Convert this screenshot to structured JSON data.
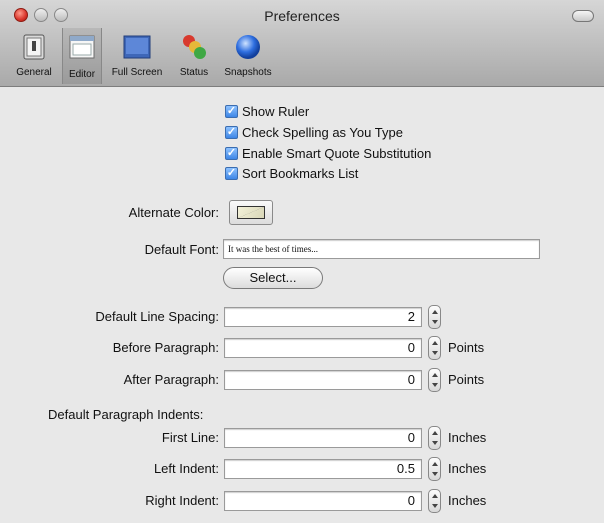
{
  "window": {
    "title": "Preferences"
  },
  "toolbar": {
    "items": [
      {
        "label": "General",
        "icon": "switch-icon"
      },
      {
        "label": "Editor",
        "icon": "editor-window-icon",
        "selected": true
      },
      {
        "label": "Full Screen",
        "icon": "full-screen-icon"
      },
      {
        "label": "Status",
        "icon": "status-lights-icon"
      },
      {
        "label": "Snapshots",
        "icon": "snapshot-orb-icon"
      }
    ]
  },
  "checkboxes": [
    {
      "label": "Show Ruler",
      "checked": true
    },
    {
      "label": "Check Spelling as You Type",
      "checked": true
    },
    {
      "label": "Enable Smart Quote Substitution",
      "checked": true
    },
    {
      "label": "Sort Bookmarks List",
      "checked": true
    }
  ],
  "alternate_color": {
    "label": "Alternate Color:",
    "color": "#ecead0"
  },
  "default_font": {
    "label": "Default Font:",
    "value": "It was the best of times...",
    "select_label": "Select..."
  },
  "spacing": {
    "line_spacing": {
      "label": "Default Line Spacing:",
      "value": "2"
    },
    "before_paragraph": {
      "label": "Before Paragraph:",
      "value": "0",
      "unit": "Points"
    },
    "after_paragraph": {
      "label": "After Paragraph:",
      "value": "0",
      "unit": "Points"
    }
  },
  "indents": {
    "heading": "Default Paragraph Indents:",
    "first_line": {
      "label": "First Line:",
      "value": "0",
      "unit": "Inches"
    },
    "left_indent": {
      "label": "Left Indent:",
      "value": "0.5",
      "unit": "Inches"
    },
    "right_indent": {
      "label": "Right Indent:",
      "value": "0",
      "unit": "Inches"
    }
  }
}
